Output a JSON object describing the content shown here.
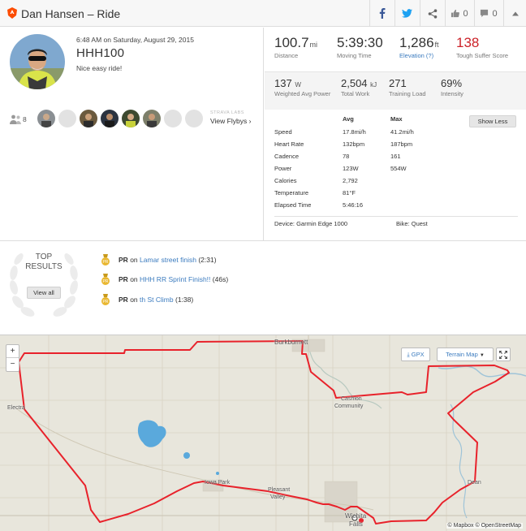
{
  "header": {
    "title": "Dan Hansen – Ride",
    "kudos_count": "0",
    "comment_count": "0"
  },
  "activity": {
    "date": "6:48 AM on Saturday, August 29, 2015",
    "name": "HHH100",
    "description": "Nice easy ride!"
  },
  "athletes": {
    "count": "8",
    "strava_labs": "STRAVA LABS",
    "view_flybys": "View Flybys"
  },
  "stats": {
    "distance_value": "100.7",
    "distance_unit": "mi",
    "distance_label": "Distance",
    "moving_time_value": "5:39:30",
    "moving_time_label": "Moving Time",
    "elevation_value": "1,286",
    "elevation_unit": "ft",
    "elevation_label": "Elevation (?)",
    "suffer_value": "138",
    "suffer_label": "Tough Suffer Score",
    "power_value": "137",
    "power_unit": "W",
    "power_label": "Weighted Avg Power",
    "work_value": "2,504",
    "work_unit": "kJ",
    "work_label": "Total Work",
    "load_value": "271",
    "load_label": "Training Load",
    "intensity_value": "69%",
    "intensity_label": "Intensity"
  },
  "details": {
    "col_avg": "Avg",
    "col_max": "Max",
    "show_less": "Show Less",
    "rows": [
      {
        "label": "Speed",
        "avg": "17.8mi/h",
        "max": "41.2mi/h"
      },
      {
        "label": "Heart Rate",
        "avg": "132bpm",
        "max": "187bpm"
      },
      {
        "label": "Cadence",
        "avg": "78",
        "max": "161"
      },
      {
        "label": "Power",
        "avg": "123W",
        "max": "554W"
      },
      {
        "label": "Calories",
        "avg": "2,792",
        "max": ""
      },
      {
        "label": "Temperature",
        "avg": "81°F",
        "max": ""
      },
      {
        "label": "Elapsed Time",
        "avg": "5:46:16",
        "max": ""
      }
    ],
    "device": "Device: Garmin Edge 1000",
    "bike": "Bike: Quest"
  },
  "results": {
    "top_label_1": "TOP",
    "top_label_2": "RESULTS",
    "view_all": "View all",
    "items": [
      {
        "pr": "PR",
        "on": "on",
        "segment": "Lamar street finish",
        "time": "(2:31)"
      },
      {
        "pr": "PR",
        "on": "on",
        "segment": "HHH RR Sprint Finish!!",
        "time": "(46s)"
      },
      {
        "pr": "PR",
        "on": "on",
        "segment": "th St Climb",
        "time": "(1:38)"
      }
    ]
  },
  "map": {
    "zoom_in": "+",
    "zoom_out": "−",
    "gpx": "GPX",
    "terrain": "Terrain Map",
    "attribution": "© Mapbox © OpenStreetMap",
    "places": {
      "burkburnett": "Burkburnett",
      "electra": "Electra",
      "cashion": "Cashion",
      "community": "Community",
      "iowa_park": "Iowa Park",
      "pleasant": "Pleasant",
      "valley": "Valley",
      "wichita": "Wichita",
      "falls": "Falls",
      "dean": "Dean"
    }
  },
  "colors": {
    "strava_orange": "#fc4c02",
    "link_blue": "#3b7bbf",
    "suffer_red": "#cc2229",
    "route_red": "#e8222b",
    "medal_gold": "#e9b730"
  }
}
